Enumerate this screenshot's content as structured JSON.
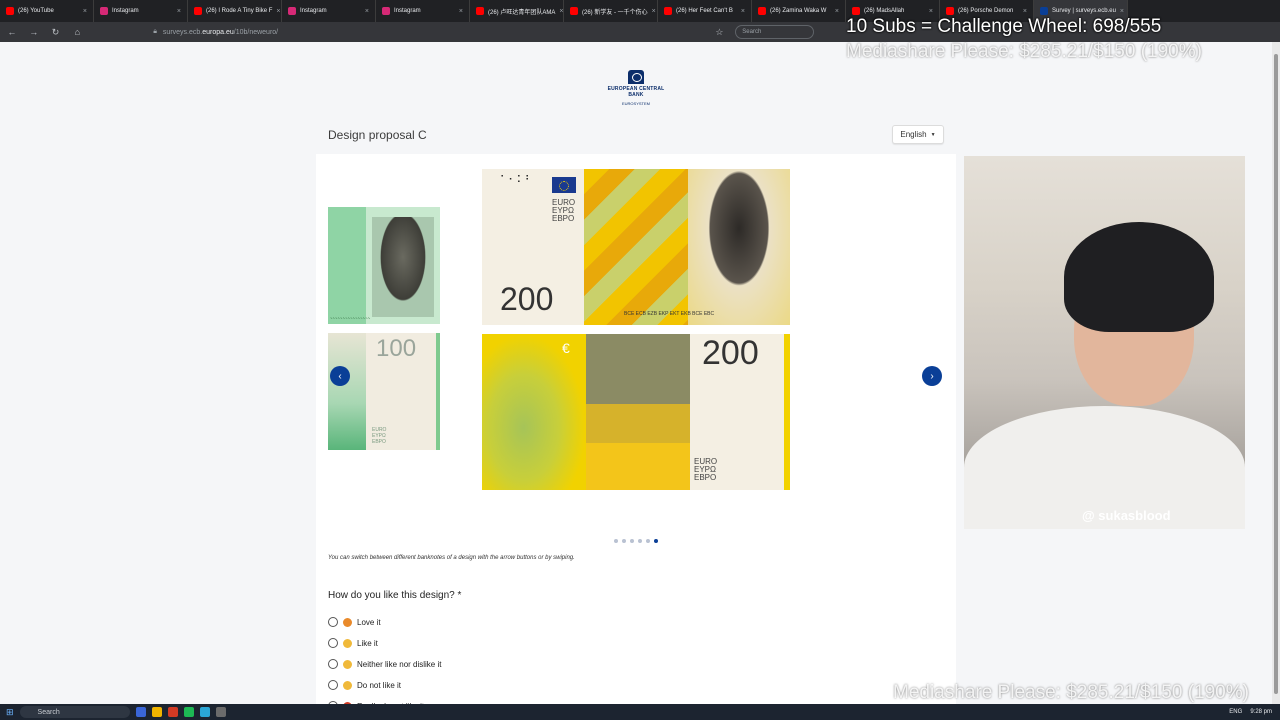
{
  "browser": {
    "tabs": [
      {
        "title": "(26) YouTube",
        "color": "#ff0000"
      },
      {
        "title": "Instagram",
        "color": "#d62976"
      },
      {
        "title": "(26) I Rode A Tiny Bike F",
        "color": "#ff0000"
      },
      {
        "title": "Instagram",
        "color": "#d62976"
      },
      {
        "title": "Instagram",
        "color": "#d62976"
      },
      {
        "title": "(26) 卢旺达青年团队AMA",
        "color": "#ff0000"
      },
      {
        "title": "(26) 新学友 - 一千个伤心",
        "color": "#ff0000"
      },
      {
        "title": "(26) Her Feet Can't B",
        "color": "#ff0000"
      },
      {
        "title": "(26) Zamina Waka W",
        "color": "#ff0000"
      },
      {
        "title": "(26) MadsAllah",
        "color": "#ff0000"
      },
      {
        "title": "(26) Porsche Demon",
        "color": "#ff0000"
      },
      {
        "title": "Survey | surveys.ecb.eu",
        "color": "#0a3f97"
      }
    ],
    "url_prefix": "surveys.ecb.",
    "url_host": "europa.eu",
    "url_path": "/10b/neweuro/",
    "search_placeholder": "Search"
  },
  "page": {
    "logo_line1": "EUROPEAN CENTRAL BANK",
    "logo_line2": "EUROSYSTEM",
    "title": "Design proposal C",
    "language": "English",
    "carousel_hint": "You can switch between different banknotes of a design with the arrow buttons or by swiping.",
    "dots_total": 6,
    "dots_active": 6,
    "question": "How do you like this design? *",
    "options": [
      {
        "label": "Love it",
        "emoji_color": "#e98a2b"
      },
      {
        "label": "Like it",
        "emoji_color": "#f0b93a"
      },
      {
        "label": "Neither like nor dislike it",
        "emoji_color": "#f0b93a"
      },
      {
        "label": "Do not like it",
        "emoji_color": "#f0b93a"
      },
      {
        "label": "Really do not like it",
        "emoji_color": "#d23a24"
      }
    ]
  },
  "banknotes": {
    "front_100_denom": "",
    "back_100_denom": "100",
    "back_100_euro": "EURO\nEYPΩ\nEBPO",
    "front_200_denom": "200",
    "front_200_euro": "EURO\nEYPΩ\nEBPO",
    "front_200_micro": "BCE ECB EZB EKP EKT EKB BCE EBC",
    "back_200_denom": "200",
    "back_200_euro": "EURO\nEYPΩ\nEBPO"
  },
  "webcam": {
    "handle": "@ sukasblood"
  },
  "overlays": {
    "line1": "10 Subs = Challenge Wheel: 698/555",
    "line2": "Mediashare Please: $285.21/$150 (190%)",
    "line3": "Mediashare Please: $285.21/$150 (190%)"
  },
  "taskbar": {
    "search": "Search",
    "language": "ENG",
    "time": "9:28 pm"
  }
}
